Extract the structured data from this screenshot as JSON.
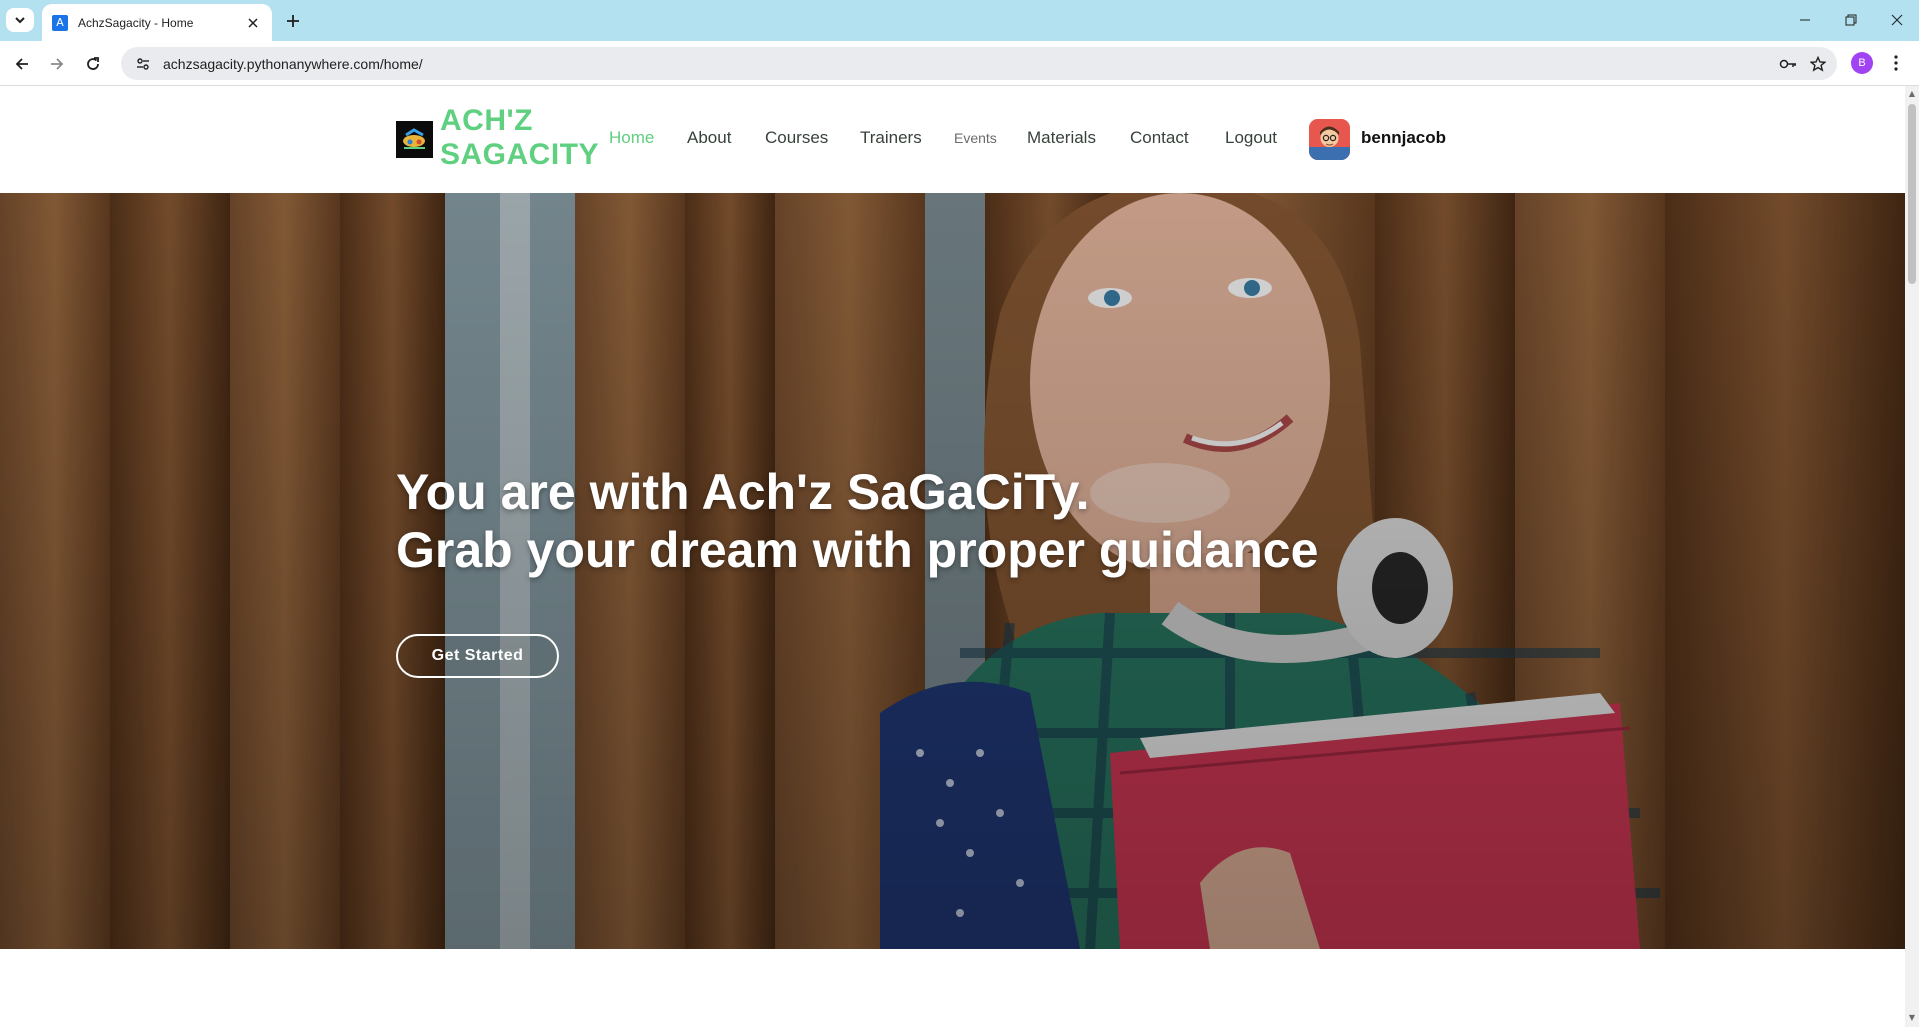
{
  "browser": {
    "tab_title": "AchzSagacity - Home",
    "tab_favicon_letter": "A",
    "url": "achzsagacity.pythonanywhere.com/home/",
    "profile_letter": "B",
    "icons": {
      "tab_search": "chevron-down-icon",
      "tab_close": "close-icon",
      "new_tab": "plus-icon",
      "back": "arrow-left-icon",
      "forward": "arrow-right-icon",
      "reload": "reload-icon",
      "site_info": "tune-icon",
      "password": "key-icon",
      "bookmark": "star-icon",
      "menu": "kebab-menu-icon",
      "minimize": "minimize-icon",
      "restore": "restore-icon",
      "close_window": "close-icon"
    }
  },
  "site": {
    "logo_line1": "ACH'Z",
    "logo_line2": "SAGACITY",
    "brand_color": "#5fcf80",
    "nav": [
      {
        "label": "Home",
        "active": true
      },
      {
        "label": "About"
      },
      {
        "label": "Courses"
      },
      {
        "label": "Trainers"
      },
      {
        "label": "Events"
      },
      {
        "label": "Materials"
      },
      {
        "label": "Contact"
      },
      {
        "label": "Logout"
      }
    ],
    "username": "bennjacob"
  },
  "hero": {
    "title_line1": "You are with Ach'z SaGaCiTy.",
    "title_line2": "Grab your dream with proper guidance",
    "cta_label": "Get Started"
  }
}
